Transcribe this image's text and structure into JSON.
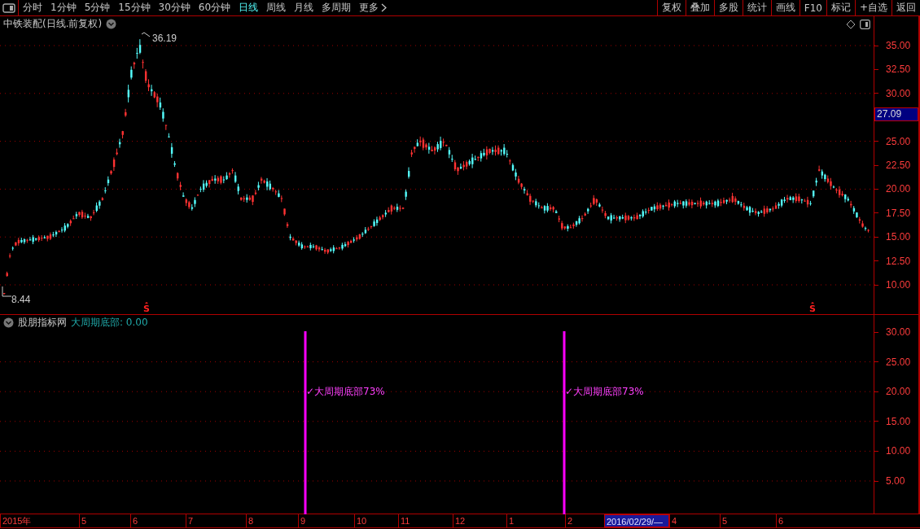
{
  "toolbar": {
    "periods": [
      {
        "label": "分时",
        "selected": false
      },
      {
        "label": "1分钟",
        "selected": false
      },
      {
        "label": "5分钟",
        "selected": false
      },
      {
        "label": "15分钟",
        "selected": false
      },
      {
        "label": "30分钟",
        "selected": false
      },
      {
        "label": "60分钟",
        "selected": false
      },
      {
        "label": "日线",
        "selected": true
      },
      {
        "label": "周线",
        "selected": false
      },
      {
        "label": "月线",
        "selected": false
      },
      {
        "label": "多周期",
        "selected": false
      },
      {
        "label": "更多",
        "selected": false
      }
    ],
    "buttons": [
      "复权",
      "叠加",
      "多股",
      "统计",
      "画线",
      "F10",
      "标记",
      "+自选",
      "返回"
    ]
  },
  "price_pane": {
    "title": "中铁装配(日线.前复权)",
    "high_label": "36.19",
    "low_label": "8.44",
    "signal_marks": [
      "S",
      "S"
    ],
    "axis_ticks": [
      "35.00",
      "32.50",
      "30.00",
      "25.00",
      "22.50",
      "20.00",
      "17.50",
      "15.00",
      "12.50",
      "10.00"
    ],
    "cursor_price": "27.09"
  },
  "indicator_pane": {
    "source": "股朋指标网",
    "name": "大周期底部: 0.00",
    "signals": [
      {
        "label": "✓大周期底部73%"
      },
      {
        "label": "✓大周期底部73%"
      }
    ],
    "axis_ticks": [
      "30.00",
      "25.00",
      "20.00",
      "15.00",
      "10.00",
      "5.00"
    ]
  },
  "time_axis": [
    {
      "label": "2015年",
      "highlighted": false
    },
    {
      "label": "5",
      "highlighted": false
    },
    {
      "label": "6",
      "highlighted": false
    },
    {
      "label": "7",
      "highlighted": false
    },
    {
      "label": "8",
      "highlighted": false
    },
    {
      "label": "9",
      "highlighted": false
    },
    {
      "label": "10",
      "highlighted": false
    },
    {
      "label": "11",
      "highlighted": false
    },
    {
      "label": "12",
      "highlighted": false
    },
    {
      "label": "1",
      "highlighted": false
    },
    {
      "label": "2",
      "highlighted": false
    },
    {
      "label": "2016/02/29/—",
      "highlighted": true
    },
    {
      "label": "4",
      "highlighted": false
    },
    {
      "label": "5",
      "highlighted": false
    },
    {
      "label": "6",
      "highlighted": false
    }
  ]
}
